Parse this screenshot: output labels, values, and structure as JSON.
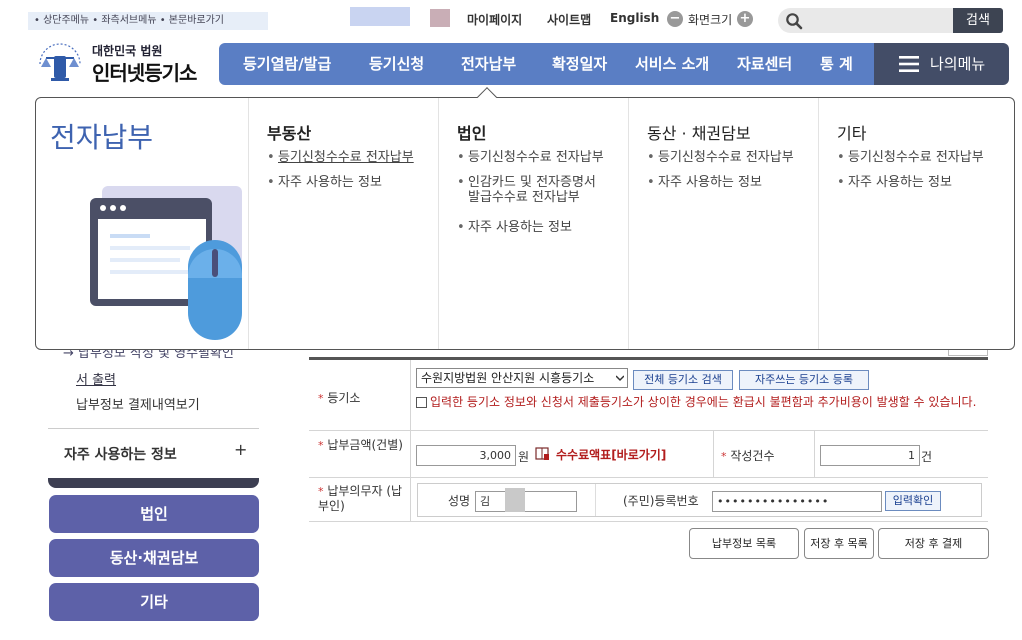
{
  "skip_links": "• 상단주메뉴 • 좌측서브메뉴 • 본문바로가기",
  "util": {
    "mypage": "마이페이지",
    "sitemap": "사이트맵",
    "english": "English",
    "zoom_label": "화면크기",
    "zoom_minus": "−",
    "zoom_plus": "+",
    "search_placeholder": "",
    "search_button": "검색"
  },
  "logo": {
    "small": "대한민국 법원",
    "big": "인터넷등기소",
    "emblem_text": "대한민국법원"
  },
  "nav": {
    "items": [
      "등기열람/발급",
      "등기신청",
      "전자납부",
      "확정일자",
      "서비스 소개",
      "자료센터",
      "통 계"
    ],
    "mymenu": "나의메뉴"
  },
  "mega": {
    "title": "전자납부",
    "columns": [
      {
        "head": "부동산",
        "items": [
          "등기신청수수료 전자납부",
          "자주 사용하는 정보"
        ]
      },
      {
        "head": "법인",
        "items": [
          "등기신청수수료 전자납부",
          "인감카드 및 전자증명서",
          "발급수수료 전자납부",
          "자주 사용하는 정보"
        ]
      },
      {
        "head": "동산 · 채권담보",
        "items": [
          "등기신청수수료 전자납부",
          "자주 사용하는 정보"
        ]
      },
      {
        "head": "기타",
        "items": [
          "등기신청수수료 전자납부",
          "자주 사용하는 정보"
        ]
      }
    ]
  },
  "leftnav": {
    "partial": "→ 납부정보 작성 및 영수필확인",
    "link": "서 출력",
    "pay_history": "납부정보 결제내역보기",
    "freq": "자주 사용하는 정보",
    "plus": "+",
    "buttons": [
      "법인",
      "동산·채권담보",
      "기타"
    ]
  },
  "form": {
    "registry_label": "등기소",
    "registry_value": "수원지방법원 안산지원 시흥등기소",
    "btn_all_search": "전체 등기소 검색",
    "btn_register_freq": "자주쓰는 등기소 등록",
    "notice": "입력한 등기소 정보와 신청서 제출등기소가 상이한 경우에는 환급시 불편함과 추가비용이 발생할 수 있습니다.",
    "amount_label": "납부금액(건별)",
    "amount_value": "3,000",
    "amount_unit": "원",
    "fee_table_link": "수수료액표[바로가기]",
    "count_label": "작성건수",
    "count_value": "1",
    "count_unit": "건",
    "payer_label": "납부의무자 (납부인)",
    "name_label": "성명",
    "name_value": "김",
    "id_label": "(주민)등록번호",
    "id_value": "•••••••••••••••",
    "btn_confirm": "입력확인",
    "btn_list": "납부정보 목록",
    "btn_save_list": "저장 후 목록",
    "btn_save_pay": "저장 후 결제"
  },
  "colors": {
    "nav_bg": "#5a7ec4",
    "mymenu_bg": "#434d67",
    "accent_title": "#3e63b0",
    "side_button": "#5d61a8"
  }
}
